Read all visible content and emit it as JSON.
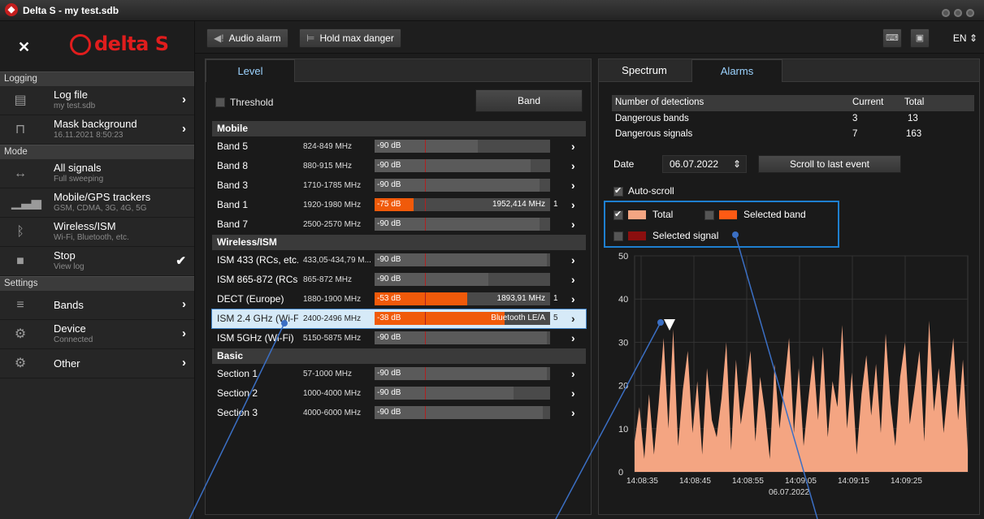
{
  "window_title": "Delta S - my test.sdb",
  "brand": "delta S",
  "sidebar": {
    "sections": [
      "Logging",
      "Mode",
      "Settings"
    ],
    "items": [
      {
        "icon": "document-icon",
        "label": "Log file",
        "sub": "my test.sdb"
      },
      {
        "icon": "mask-icon",
        "label": "Mask background",
        "sub": "16.11.2021 8:50:23"
      },
      {
        "icon": "sweep-icon",
        "label": "All signals",
        "sub": "Full sweeping"
      },
      {
        "icon": "signal-bars-icon",
        "label": "Mobile/GPS trackers",
        "sub": "GSM, CDMA, 3G, 4G, 5G"
      },
      {
        "icon": "bluetooth-icon",
        "label": "Wireless/ISM",
        "sub": "Wi-Fi, Bluetooth, etc."
      },
      {
        "icon": "stop-icon",
        "label": "Stop",
        "sub": "View log"
      },
      {
        "icon": "bands-icon",
        "label": "Bands",
        "sub": ""
      },
      {
        "icon": "device-icon",
        "label": "Device",
        "sub": "Connected"
      },
      {
        "icon": "other-icon",
        "label": "Other",
        "sub": ""
      }
    ]
  },
  "toolbar": {
    "audio_alarm": "Audio alarm",
    "hold_max": "Hold max danger",
    "lang": "EN"
  },
  "level": {
    "tab": "Level",
    "threshold_label": "Threshold",
    "band_button": "Band",
    "groups": [
      "Mobile",
      "Wireless/ISM",
      "Basic"
    ],
    "rows": [
      {
        "name": "Band 5",
        "freq": "824-849 MHz",
        "db": "-90 dB",
        "level": 0.59,
        "red": false,
        "extra": "",
        "count": ""
      },
      {
        "name": "Band 8",
        "freq": "880-915 MHz",
        "db": "-90 dB",
        "level": 0.89,
        "red": false,
        "extra": "",
        "count": ""
      },
      {
        "name": "Band 3",
        "freq": "1710-1785 MHz",
        "db": "-90 dB",
        "level": 0.94,
        "red": false,
        "extra": "",
        "count": ""
      },
      {
        "name": "Band 1",
        "freq": "1920-1980 MHz",
        "db": "-75 dB",
        "level": 0.22,
        "red": true,
        "extra": "1952,414 MHz",
        "count": "1"
      },
      {
        "name": "Band 7",
        "freq": "2500-2570 MHz",
        "db": "-90 dB",
        "level": 0.94,
        "red": false,
        "extra": "",
        "count": ""
      },
      {
        "name": "ISM 433 (RCs, etc.)",
        "freq": "433,05-434,79 M...",
        "db": "-90 dB",
        "level": 0.98,
        "red": false,
        "extra": "",
        "count": ""
      },
      {
        "name": "ISM 865-872 (RCs, etc.)",
        "freq": "865-872 MHz",
        "db": "-90 dB",
        "level": 0.65,
        "red": false,
        "extra": "",
        "count": ""
      },
      {
        "name": "DECT (Europe)",
        "freq": "1880-1900 MHz",
        "db": "-53 dB",
        "level": 0.53,
        "red": true,
        "extra": "1893,91 MHz",
        "count": "1"
      },
      {
        "name": "ISM 2.4 GHz (Wi-Fi)",
        "freq": "2400-2496 MHz",
        "db": "-38 dB",
        "level": 0.74,
        "red": true,
        "extra": "Bluetooth LE/A",
        "count": "5"
      },
      {
        "name": "ISM 5GHz (Wi-Fi)",
        "freq": "5150-5875 MHz",
        "db": "-90 dB",
        "level": 0.98,
        "red": false,
        "extra": "",
        "count": ""
      },
      {
        "name": "Section 1",
        "freq": "57-1000 MHz",
        "db": "-90 dB",
        "level": 0.98,
        "red": false,
        "extra": "",
        "count": ""
      },
      {
        "name": "Section 2",
        "freq": "1000-4000 MHz",
        "db": "-90 dB",
        "level": 0.79,
        "red": false,
        "extra": "",
        "count": ""
      },
      {
        "name": "Section 3",
        "freq": "4000-6000 MHz",
        "db": "-90 dB",
        "level": 0.96,
        "red": false,
        "extra": "",
        "count": ""
      }
    ]
  },
  "alarms": {
    "tabs": [
      "Spectrum",
      "Alarms"
    ],
    "detections": {
      "header": [
        "Number of detections",
        "Current",
        "Total"
      ],
      "rows": [
        [
          "Dangerous bands",
          "3",
          "13"
        ],
        [
          "Dangerous signals",
          "7",
          "163"
        ]
      ]
    },
    "date_label": "Date",
    "date_value": "06.07.2022",
    "scroll_button": "Scroll to last event",
    "auto_scroll": "Auto-scroll",
    "legend": {
      "total": "Total",
      "selected_band": "Selected band",
      "selected_signal": "Selected signal"
    },
    "colors": {
      "total": "#f4a582",
      "selected_band": "#ff5a14",
      "selected_signal": "#8b0f0f",
      "accent": "#1e7fd0"
    }
  },
  "chart_data": {
    "type": "area",
    "title": "",
    "xlabel": "06.07.2022",
    "ylabel": "",
    "ylim": [
      0,
      50
    ],
    "yticks": [
      "0",
      "10",
      "20",
      "30",
      "40",
      "50"
    ],
    "xticks": [
      "14:08:35",
      "14:08:45",
      "14:08:55",
      "14:09:05",
      "14:09:15",
      "14:09:25"
    ],
    "series": [
      {
        "values": [
          7,
          15,
          3,
          18,
          4,
          16,
          31,
          10,
          33,
          6,
          19,
          28,
          9,
          21,
          4,
          24,
          12,
          8,
          17,
          30,
          5,
          26,
          11,
          19,
          28,
          7,
          22,
          14,
          3,
          25,
          10,
          20,
          31,
          9,
          24,
          6,
          17,
          27,
          12,
          29,
          8,
          21,
          15,
          34,
          10,
          23,
          4,
          18,
          27,
          13,
          25,
          9,
          32,
          16,
          6,
          22,
          30,
          11,
          19,
          28,
          7,
          35,
          14,
          24,
          9,
          20,
          31,
          12,
          26,
          5
        ]
      }
    ]
  }
}
